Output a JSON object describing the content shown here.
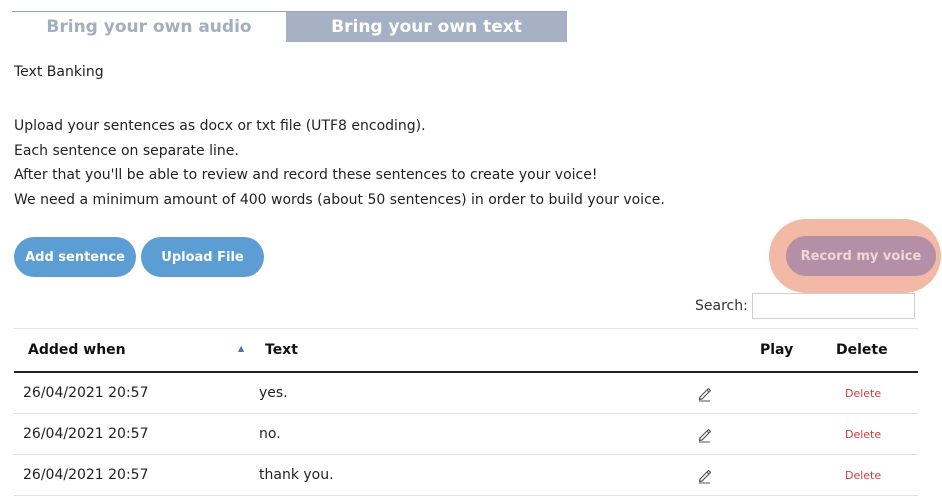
{
  "tabs": [
    {
      "label": "Bring your own audio"
    },
    {
      "label": "Bring your own text"
    }
  ],
  "page_title": "Text Banking",
  "instructions": [
    "Upload your sentences as docx or txt file (UTF8 encoding).",
    "Each sentence on separate line.",
    "After that you'll be able to review and record these sentences to create your voice!",
    "We need a minimum amount of 400 words (about 50 sentences) in order to build your voice."
  ],
  "buttons": {
    "add_sentence": "Add sentence",
    "upload_file": "Upload File",
    "record_voice": "Record my voice"
  },
  "search": {
    "label": "Search:",
    "value": ""
  },
  "table": {
    "columns": [
      "Added when",
      "Text",
      "Play",
      "Delete"
    ],
    "sort_icon": "sort-ascending-icon",
    "rows": [
      {
        "added": "26/04/2021 20:57",
        "text": "yes.",
        "delete": "Delete"
      },
      {
        "added": "26/04/2021 20:57",
        "text": "no.",
        "delete": "Delete"
      },
      {
        "added": "26/04/2021 20:57",
        "text": "thank you.",
        "delete": "Delete"
      }
    ]
  },
  "colors": {
    "button_blue": "#5c9ed4",
    "record_highlight": "#f2b9a6",
    "record_button": "#b48fa6",
    "active_tab": "#a6b1c5",
    "delete_red": "#d23c3c"
  }
}
